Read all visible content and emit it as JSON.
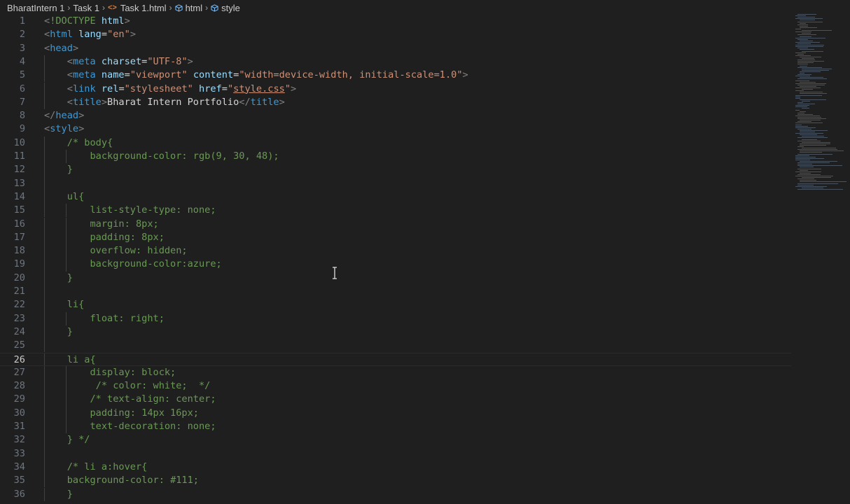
{
  "breadcrumb": {
    "items": [
      "BharatIntern 1",
      "Task 1",
      "Task 1.html",
      "html",
      "style"
    ]
  },
  "editor": {
    "current_line": 26,
    "lines": [
      {
        "n": "1",
        "tokens": [
          [
            "t-punct",
            "<"
          ],
          [
            "t-com",
            "!DOCTYPE"
          ],
          [
            "t-text",
            " "
          ],
          [
            "t-attr",
            "html"
          ],
          [
            "t-punct",
            ">"
          ]
        ]
      },
      {
        "n": "2",
        "tokens": [
          [
            "t-punct",
            "<"
          ],
          [
            "t-tag",
            "html"
          ],
          [
            "t-text",
            " "
          ],
          [
            "t-attr",
            "lang"
          ],
          [
            "t-text",
            "="
          ],
          [
            "t-str",
            "\"en\""
          ],
          [
            "t-punct",
            ">"
          ]
        ]
      },
      {
        "n": "3",
        "tokens": [
          [
            "t-punct",
            "<"
          ],
          [
            "t-tag",
            "head"
          ],
          [
            "t-punct",
            ">"
          ]
        ]
      },
      {
        "n": "4",
        "tokens": [
          [
            "t-text",
            "    "
          ],
          [
            "t-punct",
            "<"
          ],
          [
            "t-tag",
            "meta"
          ],
          [
            "t-text",
            " "
          ],
          [
            "t-attr",
            "charset"
          ],
          [
            "t-text",
            "="
          ],
          [
            "t-str",
            "\"UTF-8\""
          ],
          [
            "t-punct",
            ">"
          ]
        ]
      },
      {
        "n": "5",
        "tokens": [
          [
            "t-text",
            "    "
          ],
          [
            "t-punct",
            "<"
          ],
          [
            "t-tag",
            "meta"
          ],
          [
            "t-text",
            " "
          ],
          [
            "t-attr",
            "name"
          ],
          [
            "t-text",
            "="
          ],
          [
            "t-str",
            "\"viewport\""
          ],
          [
            "t-text",
            " "
          ],
          [
            "t-attr",
            "content"
          ],
          [
            "t-text",
            "="
          ],
          [
            "t-str",
            "\"width=device-width, initial-scale=1.0\""
          ],
          [
            "t-punct",
            ">"
          ]
        ]
      },
      {
        "n": "6",
        "tokens": [
          [
            "t-text",
            "    "
          ],
          [
            "t-punct",
            "<"
          ],
          [
            "t-tag",
            "link"
          ],
          [
            "t-text",
            " "
          ],
          [
            "t-attr",
            "rel"
          ],
          [
            "t-text",
            "="
          ],
          [
            "t-str",
            "\"stylesheet\""
          ],
          [
            "t-text",
            " "
          ],
          [
            "t-attr",
            "href"
          ],
          [
            "t-text",
            "="
          ],
          [
            "t-str",
            "\""
          ],
          [
            "t-link",
            "style.css"
          ],
          [
            "t-str",
            "\""
          ],
          [
            "t-punct",
            ">"
          ]
        ]
      },
      {
        "n": "7",
        "tokens": [
          [
            "t-text",
            "    "
          ],
          [
            "t-punct",
            "<"
          ],
          [
            "t-tag",
            "title"
          ],
          [
            "t-punct",
            ">"
          ],
          [
            "t-text",
            "Bharat Intern Portfolio"
          ],
          [
            "t-punct",
            "</"
          ],
          [
            "t-tag",
            "title"
          ],
          [
            "t-punct",
            ">"
          ]
        ]
      },
      {
        "n": "8",
        "tokens": [
          [
            "t-punct",
            "</"
          ],
          [
            "t-tag",
            "head"
          ],
          [
            "t-punct",
            ">"
          ]
        ]
      },
      {
        "n": "9",
        "tokens": [
          [
            "t-punct",
            "<"
          ],
          [
            "t-tag",
            "style"
          ],
          [
            "t-punct",
            ">"
          ]
        ]
      },
      {
        "n": "10",
        "tokens": [
          [
            "t-text",
            "    "
          ],
          [
            "t-com",
            "/* body{"
          ]
        ]
      },
      {
        "n": "11",
        "tokens": [
          [
            "t-text",
            "        "
          ],
          [
            "t-com",
            "background-color: rgb(9, 30, 48);"
          ]
        ]
      },
      {
        "n": "12",
        "tokens": [
          [
            "t-text",
            "    "
          ],
          [
            "t-com",
            "}"
          ]
        ]
      },
      {
        "n": "13",
        "tokens": []
      },
      {
        "n": "14",
        "tokens": [
          [
            "t-text",
            "    "
          ],
          [
            "t-com",
            "ul{"
          ]
        ]
      },
      {
        "n": "15",
        "tokens": [
          [
            "t-text",
            "        "
          ],
          [
            "t-com",
            "list-style-type: none;"
          ]
        ]
      },
      {
        "n": "16",
        "tokens": [
          [
            "t-text",
            "        "
          ],
          [
            "t-com",
            "margin: 8px;"
          ]
        ]
      },
      {
        "n": "17",
        "tokens": [
          [
            "t-text",
            "        "
          ],
          [
            "t-com",
            "padding: 8px;"
          ]
        ]
      },
      {
        "n": "18",
        "tokens": [
          [
            "t-text",
            "        "
          ],
          [
            "t-com",
            "overflow: hidden;"
          ]
        ]
      },
      {
        "n": "19",
        "tokens": [
          [
            "t-text",
            "        "
          ],
          [
            "t-com",
            "background-color:azure;"
          ]
        ]
      },
      {
        "n": "20",
        "tokens": [
          [
            "t-text",
            "    "
          ],
          [
            "t-com",
            "}"
          ]
        ]
      },
      {
        "n": "21",
        "tokens": []
      },
      {
        "n": "22",
        "tokens": [
          [
            "t-text",
            "    "
          ],
          [
            "t-com",
            "li{"
          ]
        ]
      },
      {
        "n": "23",
        "tokens": [
          [
            "t-text",
            "        "
          ],
          [
            "t-com",
            "float: right;"
          ]
        ]
      },
      {
        "n": "24",
        "tokens": [
          [
            "t-text",
            "    "
          ],
          [
            "t-com",
            "}"
          ]
        ]
      },
      {
        "n": "25",
        "tokens": []
      },
      {
        "n": "26",
        "tokens": [
          [
            "t-text",
            "    "
          ],
          [
            "t-com",
            "li a{"
          ]
        ]
      },
      {
        "n": "27",
        "tokens": [
          [
            "t-text",
            "        "
          ],
          [
            "t-com",
            "display: block;"
          ]
        ]
      },
      {
        "n": "28",
        "tokens": [
          [
            "t-text",
            "         "
          ],
          [
            "t-com",
            "/* color: white;  */"
          ]
        ]
      },
      {
        "n": "29",
        "tokens": [
          [
            "t-text",
            "        "
          ],
          [
            "t-com",
            "/* text-align: center;"
          ]
        ]
      },
      {
        "n": "30",
        "tokens": [
          [
            "t-text",
            "        "
          ],
          [
            "t-com",
            "padding: 14px 16px;"
          ]
        ]
      },
      {
        "n": "31",
        "tokens": [
          [
            "t-text",
            "        "
          ],
          [
            "t-com",
            "text-decoration: none;"
          ]
        ]
      },
      {
        "n": "32",
        "tokens": [
          [
            "t-text",
            "    "
          ],
          [
            "t-com",
            "} */"
          ]
        ]
      },
      {
        "n": "33",
        "tokens": []
      },
      {
        "n": "34",
        "tokens": [
          [
            "t-text",
            "    "
          ],
          [
            "t-com",
            "/* li a:hover{"
          ]
        ]
      },
      {
        "n": "35",
        "tokens": [
          [
            "t-text",
            "    "
          ],
          [
            "t-com",
            "background-color: #111;"
          ]
        ]
      },
      {
        "n": "36",
        "tokens": [
          [
            "t-text",
            "    "
          ],
          [
            "t-com",
            "}"
          ]
        ]
      }
    ]
  }
}
